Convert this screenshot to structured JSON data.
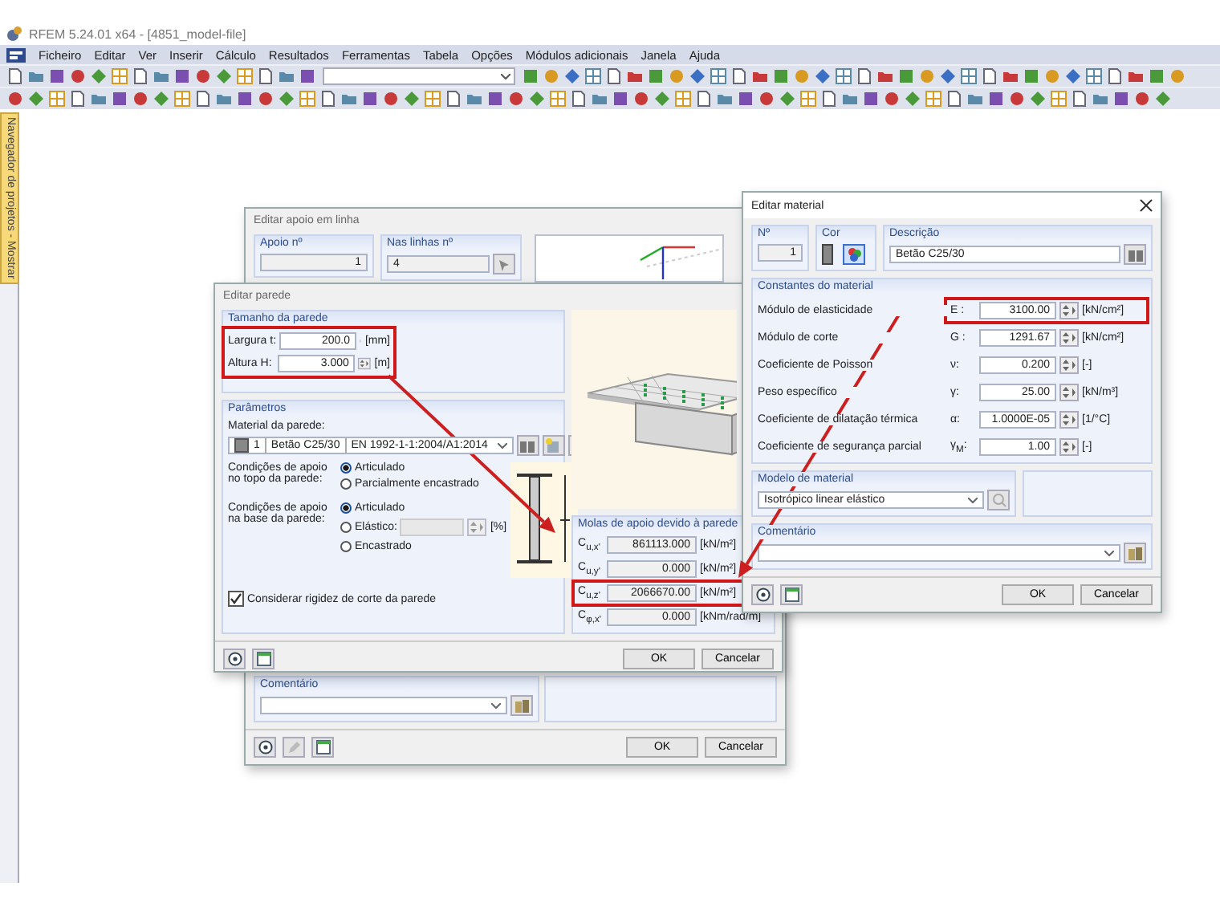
{
  "window": {
    "title": "RFEM 5.24.01 x64 - [4851_model-file]"
  },
  "menu": [
    "Ficheiro",
    "Editar",
    "Ver",
    "Inserir",
    "Cálculo",
    "Resultados",
    "Ferramentas",
    "Tabela",
    "Opções",
    "Módulos adicionais",
    "Janela",
    "Ajuda"
  ],
  "side_panel": {
    "label": "Navegador de projetos - Mostrar"
  },
  "line_support_dialog": {
    "title": "Editar apoio em linha",
    "support_no": {
      "label": "Apoio nº",
      "value": "1"
    },
    "on_lines": {
      "label": "Nas linhas nº",
      "value": "4"
    },
    "comment": {
      "label": "Comentário"
    },
    "buttons": [
      "OK",
      "Cancelar"
    ]
  },
  "wall_dialog": {
    "title": "Editar parede",
    "size_group": {
      "title": "Tamanho da parede",
      "highlighted": true,
      "rows": [
        {
          "label": "Largura",
          "symbol": "t:",
          "value": "200.0",
          "unit": "[mm]"
        },
        {
          "label": "Altura",
          "symbol": "H:",
          "value": "3.000",
          "unit": "[m]"
        }
      ]
    },
    "params_group": {
      "title": "Parâmetros",
      "material_label": "Material da parede:",
      "material": {
        "no": "1",
        "name": "Betão C25/30",
        "norm": "EN 1992-1-1:2004/A1:2014"
      },
      "top_condition": {
        "label": "Condições de apoio no topo da parede:",
        "options": [
          {
            "label": "Articulado",
            "selected": true
          },
          {
            "label": "Parcialmente encastrado",
            "selected": false
          }
        ]
      },
      "base_condition": {
        "label": "Condições de apoio na base da parede:",
        "options": [
          {
            "label": "Articulado",
            "selected": true,
            "kind": "plain"
          },
          {
            "label": "Elástico:",
            "selected": false,
            "kind": "field",
            "field_disabled": true,
            "unit": "[%]"
          },
          {
            "label": "Encastrado",
            "selected": false,
            "kind": "plain"
          }
        ]
      },
      "shear_stiffness": {
        "label": "Considerar rigidez de corte da parede",
        "checked": true
      }
    },
    "springs_group": {
      "title": "Molas de apoio devido à parede",
      "rows": [
        {
          "symbol": "C$_{u,x'}$",
          "value": "861113.000",
          "unit": "[kN/m²]",
          "highlighted": false
        },
        {
          "symbol": "C$_{u,y'}$",
          "value": "0.000",
          "unit": "[kN/m²]",
          "highlighted": false
        },
        {
          "symbol": "C$_{u,z'}$",
          "value": "2066670.00",
          "unit": "[kN/m²]",
          "highlighted": true
        },
        {
          "symbol": "C$_{φ,x'}$",
          "value": "0.000",
          "unit": "[kNm/rad/m]",
          "highlighted": false
        }
      ]
    },
    "buttons": [
      "OK",
      "Cancelar"
    ]
  },
  "material_dialog": {
    "title": "Editar material",
    "no": {
      "label": "Nº",
      "value": "1"
    },
    "color": {
      "label": "Cor"
    },
    "description": {
      "label": "Descrição",
      "value": "Betão C25/30"
    },
    "constants": {
      "title": "Constantes do material",
      "rows": [
        {
          "label": "Módulo de elasticidade",
          "symbol": "E :",
          "value": "3100.00",
          "unit": "[kN/cm²]",
          "highlighted": true
        },
        {
          "label": "Módulo de corte",
          "symbol": "G :",
          "value": "1291.67",
          "unit": "[kN/cm²]",
          "highlighted": false
        },
        {
          "label": "Coeficiente de Poisson",
          "symbol": "ν:",
          "value": "0.200",
          "unit": "[-]",
          "highlighted": false
        },
        {
          "label": "Peso específico",
          "symbol": "γ:",
          "value": "25.00",
          "unit": "[kN/m³]",
          "highlighted": false
        },
        {
          "label": "Coeficiente de dilatação térmica",
          "symbol": "α:",
          "value": "1.0000E-05",
          "unit": "[1/°C]",
          "highlighted": false
        },
        {
          "label": "Coeficiente de segurança parcial",
          "symbol": "γ$_{M}$:",
          "value": "1.00",
          "unit": "[-]",
          "highlighted": false
        }
      ]
    },
    "model": {
      "label": "Modelo de material",
      "value": "Isotrópico linear elástico"
    },
    "comment": {
      "label": "Comentário"
    },
    "buttons": [
      "OK",
      "Cancelar"
    ]
  }
}
